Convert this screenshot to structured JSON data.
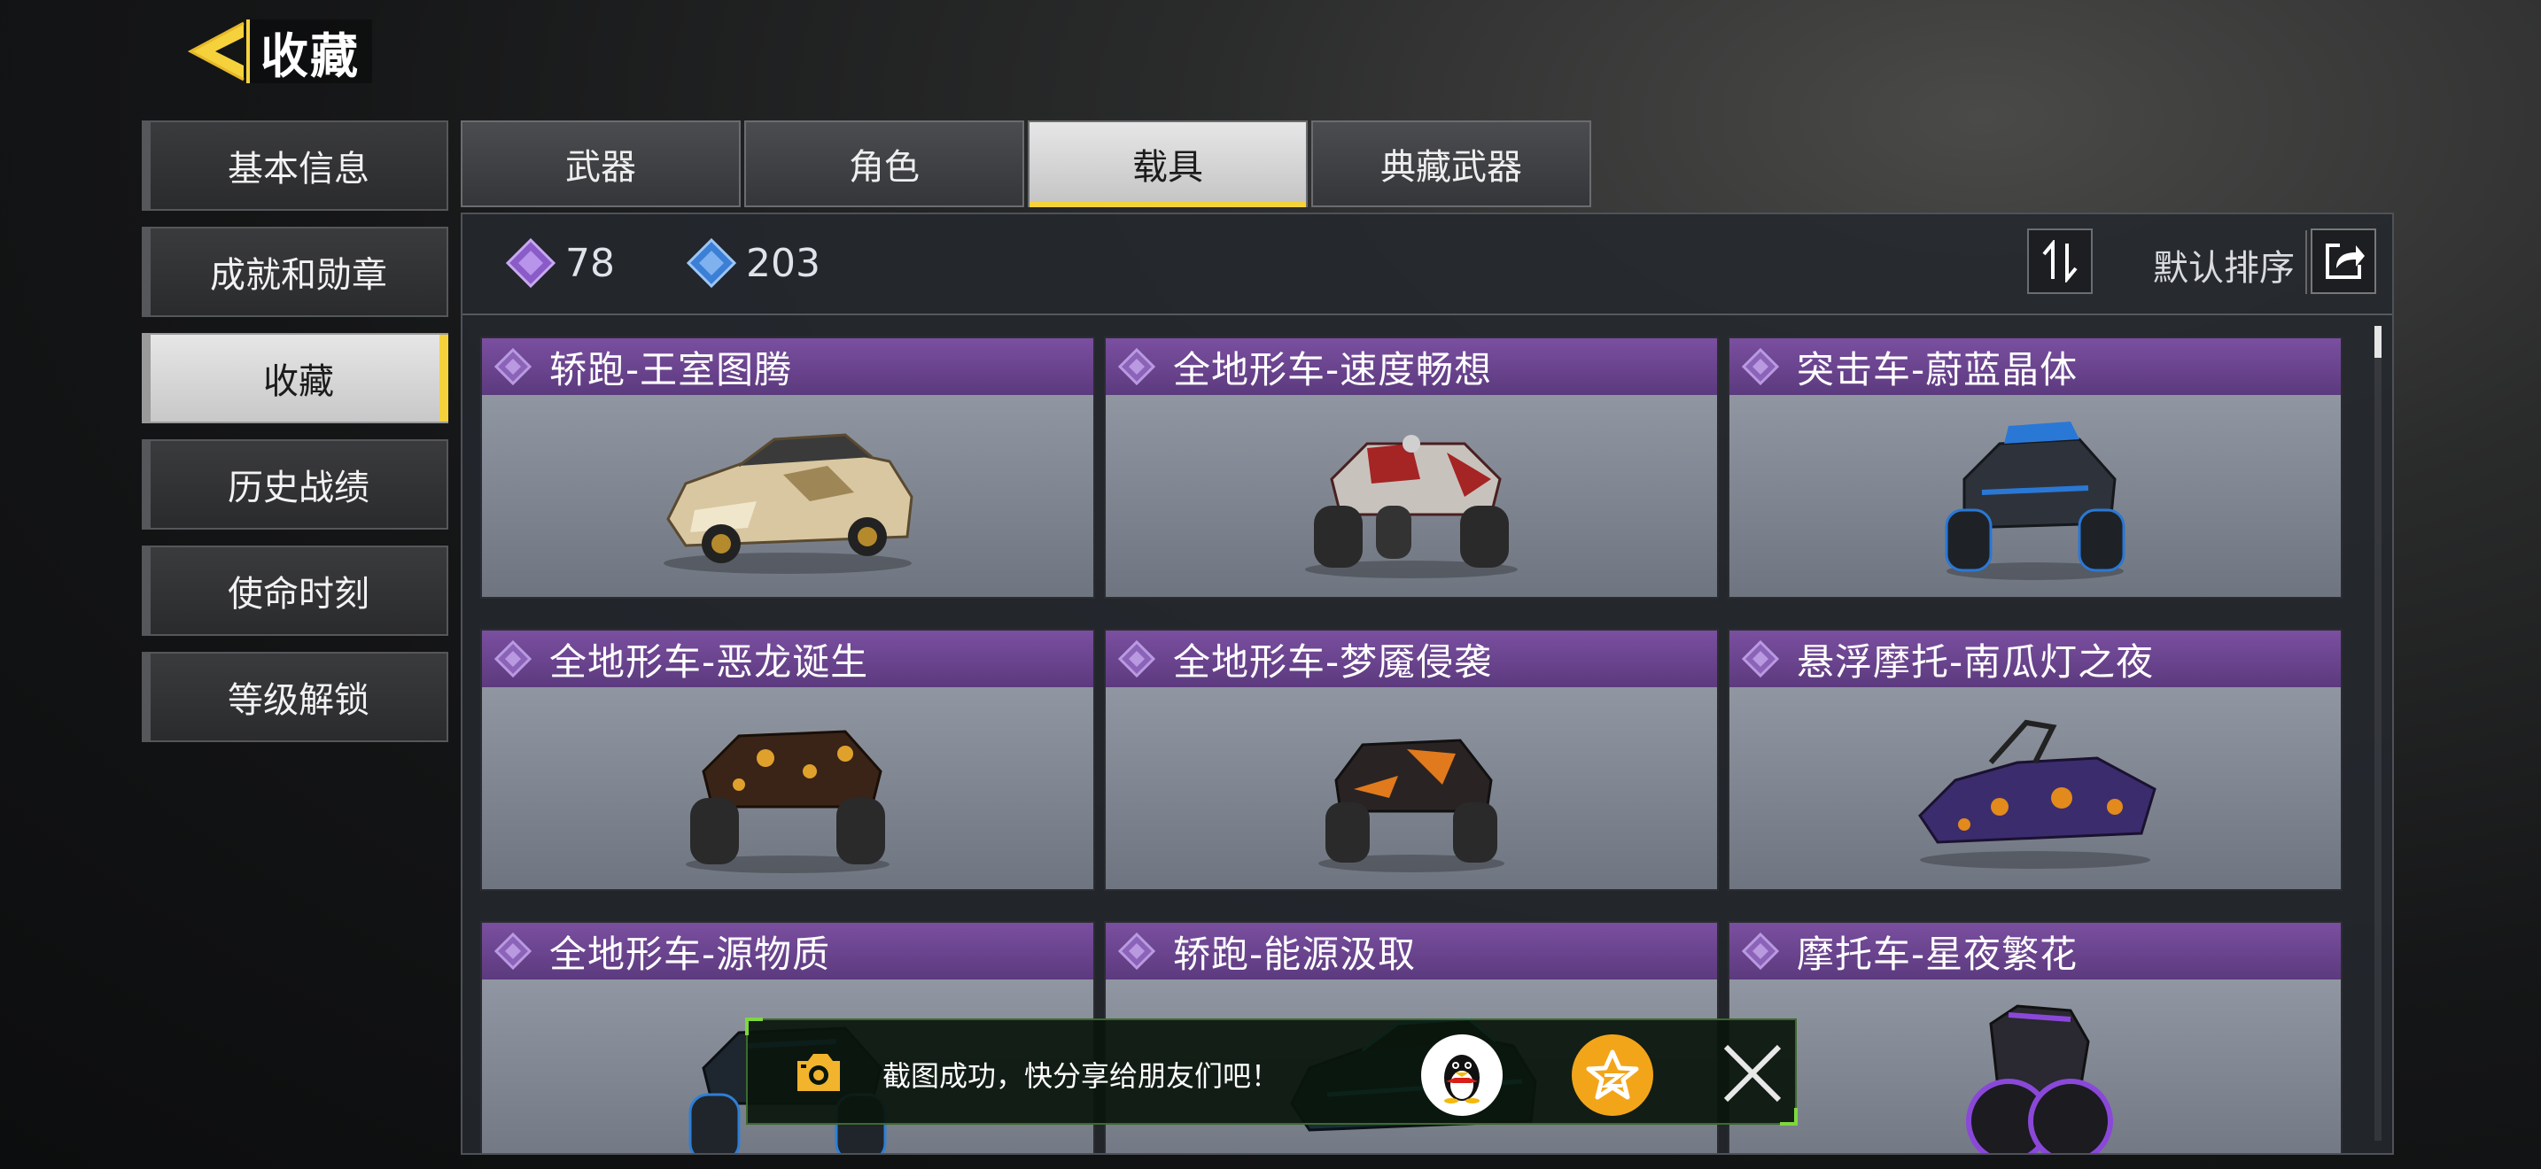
{
  "header": {
    "title": "收藏"
  },
  "sidebar": {
    "items": [
      {
        "label": "基本信息",
        "active": false
      },
      {
        "label": "成就和勋章",
        "active": false
      },
      {
        "label": "收藏",
        "active": true
      },
      {
        "label": "历史战绩",
        "active": false
      },
      {
        "label": "使命时刻",
        "active": false
      },
      {
        "label": "等级解锁",
        "active": false
      }
    ]
  },
  "tabs": [
    {
      "label": "武器",
      "active": false
    },
    {
      "label": "角色",
      "active": false
    },
    {
      "label": "载具",
      "active": true
    },
    {
      "label": "典藏武器",
      "active": false
    }
  ],
  "stats": {
    "purple_count": "78",
    "blue_count": "203"
  },
  "sort": {
    "label": "默认排序"
  },
  "cards": [
    {
      "name": "轿跑-王室图腾",
      "vehicle": "sports-car",
      "body_color": "#d8c7a0",
      "accent_color": "#7a5a24"
    },
    {
      "name": "全地形车-速度畅想",
      "vehicle": "atv",
      "body_color": "#c8c2bd",
      "accent_color": "#a52424"
    },
    {
      "name": "突击车-蔚蓝晶体",
      "vehicle": "assault-buggy",
      "body_color": "#2e333b",
      "accent_color": "#2a78d6"
    },
    {
      "name": "全地形车-恶龙诞生",
      "vehicle": "atv",
      "body_color": "#3a2418",
      "accent_color": "#e0a12c"
    },
    {
      "name": "全地形车-梦魇侵袭",
      "vehicle": "atv",
      "body_color": "#2a2322",
      "accent_color": "#e07a1c"
    },
    {
      "name": "悬浮摩托-南瓜灯之夜",
      "vehicle": "hoverbike",
      "body_color": "#3b2c6e",
      "accent_color": "#e28a1c"
    },
    {
      "name": "全地形车-源物质",
      "vehicle": "atv",
      "body_color": "#1e2630",
      "accent_color": "#2e7fd6"
    },
    {
      "name": "轿跑-能源汲取",
      "vehicle": "sports-car",
      "body_color": "#1a2d3a",
      "accent_color": "#21c3d6"
    },
    {
      "name": "摩托车-星夜繁花",
      "vehicle": "motorcycle",
      "body_color": "#2a2830",
      "accent_color": "#8a48d8"
    }
  ],
  "toast": {
    "message": "截图成功，快分享给朋友们吧！"
  },
  "colors": {
    "accent_yellow": "#f5d23b",
    "card_title_purple": "#6a4590",
    "toast_border_green": "#7fd640",
    "share_orange": "#f3a51a"
  }
}
